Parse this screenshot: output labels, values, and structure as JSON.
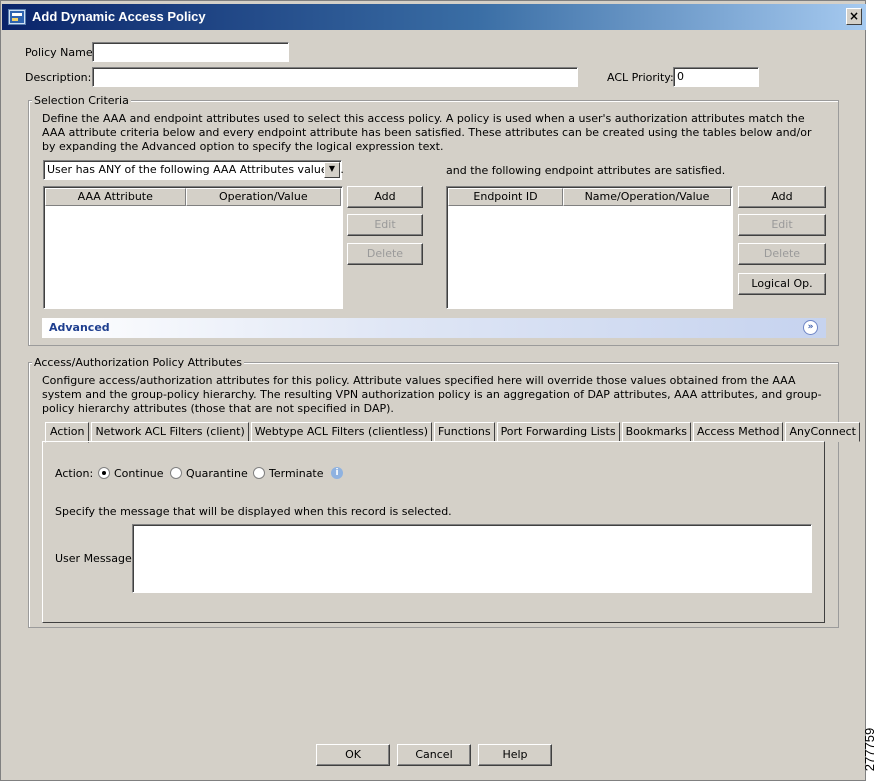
{
  "window": {
    "title": "Add Dynamic Access Policy",
    "close_label": "×"
  },
  "policy": {
    "name_label": "Policy Name:",
    "name_value": "",
    "description_label": "Description:",
    "description_value": "",
    "acl_priority_label": "ACL Priority:",
    "acl_priority_value": "0"
  },
  "selection_criteria": {
    "legend": "Selection Criteria",
    "description": "Define the AAA and endpoint attributes used to select this access policy. A policy is used when a user's authorization attributes match the AAA attribute criteria below and every endpoint attribute has been satisfied. These attributes can be created using the tables below and/or by expanding the Advanced option to specify the logical expression text.",
    "aaa_match_selected": "User has ANY of the following AAA Attributes values...",
    "endpoint_caption": "and the following endpoint attributes are satisfied.",
    "aaa_table": {
      "columns": [
        "AAA Attribute",
        "Operation/Value"
      ],
      "rows": []
    },
    "aaa_buttons": {
      "add": "Add",
      "edit": "Edit",
      "delete": "Delete"
    },
    "endpoint_table": {
      "columns": [
        "Endpoint ID",
        "Name/Operation/Value"
      ],
      "rows": []
    },
    "endpoint_buttons": {
      "add": "Add",
      "edit": "Edit",
      "delete": "Delete",
      "logical_op": "Logical Op."
    },
    "advanced_label": "Advanced"
  },
  "access_attributes": {
    "legend": "Access/Authorization Policy Attributes",
    "description": "Configure access/authorization attributes for this policy. Attribute values specified here will override those values obtained from the AAA system and the group-policy hierarchy. The resulting VPN authorization policy is an aggregation of DAP attributes, AAA attributes, and group-policy hierarchy attributes (those that are not specified in DAP).",
    "tabs": [
      "Action",
      "Network ACL Filters (client)",
      "Webtype ACL Filters (clientless)",
      "Functions",
      "Port Forwarding Lists",
      "Bookmarks",
      "Access Method",
      "AnyConnect"
    ],
    "active_tab": "Action",
    "action": {
      "label": "Action:",
      "options": [
        "Continue",
        "Quarantine",
        "Terminate"
      ],
      "selected": "Continue",
      "message_instruction": "Specify the message that will be displayed when this record is selected.",
      "user_message_label": "User Message:",
      "user_message_value": ""
    }
  },
  "footer": {
    "ok": "OK",
    "cancel": "Cancel",
    "help": "Help"
  },
  "figure_id": "277759"
}
